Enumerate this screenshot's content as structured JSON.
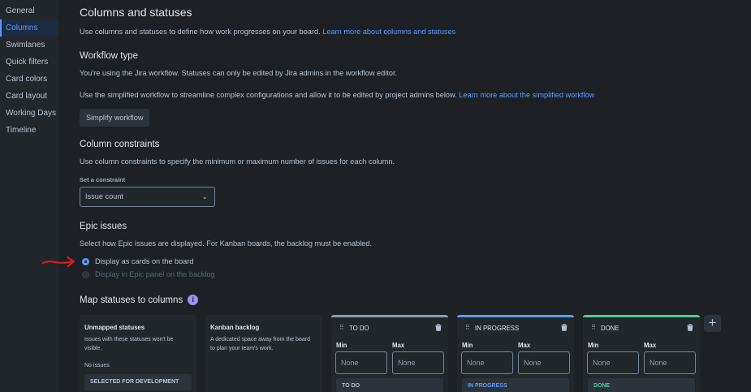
{
  "sidebar": {
    "items": [
      {
        "label": "General"
      },
      {
        "label": "Columns"
      },
      {
        "label": "Swimlanes"
      },
      {
        "label": "Quick filters"
      },
      {
        "label": "Card colors"
      },
      {
        "label": "Card layout"
      },
      {
        "label": "Working Days"
      },
      {
        "label": "Timeline"
      }
    ]
  },
  "header": {
    "title": "Columns and statuses",
    "desc": "Use columns and statuses to define how work progresses on your board.",
    "desc_link": "Learn more about columns and statuses"
  },
  "workflow": {
    "title": "Workflow type",
    "line1": "You're using the Jira workflow. Statuses can only be edited by Jira admins in the workflow editor.",
    "line2": "Use the simplified workflow to streamline complex configurations and allow it to be edited by project admins below.",
    "line2_link": "Learn more about the simplified workflow",
    "button": "Simplify workflow"
  },
  "constraints": {
    "title": "Column constraints",
    "desc": "Use column constraints to specify the minimum or maximum number of issues for each column.",
    "select_label": "Set a constraint",
    "select_value": "Issue count"
  },
  "epic": {
    "title": "Epic issues",
    "desc": "Select how Epic issues are displayed. For Kanban boards, the backlog must be enabled.",
    "option1": "Display as cards on the board",
    "option2": "Display in Epic panel on the backlog"
  },
  "map": {
    "title": "Map statuses to columns",
    "unmapped": {
      "title": "Unmapped statuses",
      "desc": "Issues with these statuses won't be visible.",
      "no_issues": "No issues",
      "status": "SELECTED FOR DEVELOPMENT"
    },
    "backlog": {
      "title": "Kanban backlog",
      "desc": "A dedicated space away from the board to plan your team's work."
    },
    "min_label": "Min",
    "max_label": "Max",
    "none": "None",
    "columns": [
      {
        "name": "TO DO",
        "status": "TO DO",
        "bar_color": "#8c9bab",
        "status_color": "#b6c2cf"
      },
      {
        "name": "IN PROGRESS",
        "status": "IN PROGRESS",
        "bar_color": "#579dff",
        "status_color": "#579dff"
      },
      {
        "name": "DONE",
        "status": "DONE",
        "bar_color": "#4bce97",
        "status_color": "#4bce97"
      }
    ]
  }
}
